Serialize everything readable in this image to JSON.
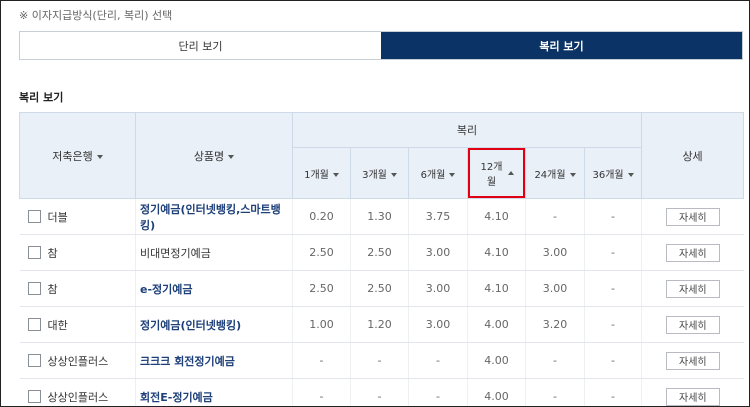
{
  "notice": "※ 이자지급방식(단리, 복리) 선택",
  "toggle": {
    "simple_label": "단리 보기",
    "compound_label": "복리 보기"
  },
  "section_title": "복리 보기",
  "table": {
    "headers": {
      "bank": "저축은행",
      "product": "상품명",
      "group": "복리",
      "detail": "상세",
      "terms": [
        "1개월",
        "3개월",
        "6개월",
        "12개월",
        "24개월",
        "36개월"
      ]
    },
    "rows": [
      {
        "bank": "더블",
        "product": "정기예금(인터넷뱅킹,스마트뱅킹)",
        "link": true,
        "rates": [
          "0.20",
          "1.30",
          "3.75",
          "4.10",
          "-",
          "-"
        ],
        "detail": "자세히"
      },
      {
        "bank": "참",
        "product": "비대면정기예금",
        "link": false,
        "rates": [
          "2.50",
          "2.50",
          "3.00",
          "4.10",
          "3.00",
          "-"
        ],
        "detail": "자세히"
      },
      {
        "bank": "참",
        "product": "e-정기예금",
        "link": true,
        "rates": [
          "2.50",
          "2.50",
          "3.00",
          "4.10",
          "3.00",
          "-"
        ],
        "detail": "자세히"
      },
      {
        "bank": "대한",
        "product": "정기예금(인터넷뱅킹)",
        "link": true,
        "rates": [
          "1.00",
          "1.20",
          "3.00",
          "4.00",
          "3.20",
          "-"
        ],
        "detail": "자세히"
      },
      {
        "bank": "상상인플러스",
        "product": "크크크 회전정기예금",
        "link": true,
        "rates": [
          "-",
          "-",
          "-",
          "4.00",
          "-",
          "-"
        ],
        "detail": "자세히"
      },
      {
        "bank": "상상인플러스",
        "product": "회전E-정기예금",
        "link": true,
        "rates": [
          "-",
          "-",
          "-",
          "4.00",
          "-",
          "-"
        ],
        "detail": "자세히"
      }
    ]
  },
  "colors": {
    "accent_navy": "#0b3366",
    "header_bg": "#eaf0f8",
    "highlight_red": "#e00012"
  },
  "icons": {
    "sort": "caret-down-icon",
    "sort_active": "caret-up-icon"
  }
}
